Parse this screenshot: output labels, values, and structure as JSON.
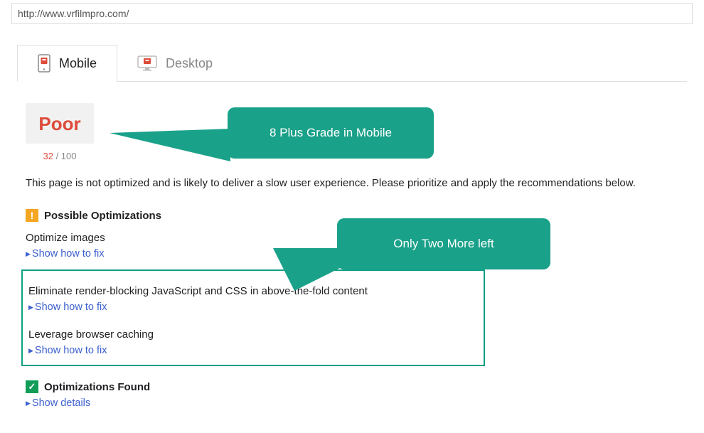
{
  "url": "http://www.vrfilmpro.com/",
  "tabs": {
    "mobile": "Mobile",
    "desktop": "Desktop"
  },
  "score": {
    "grade": "Poor",
    "value": "32",
    "sep": " / ",
    "max": "100"
  },
  "description": "This page is not optimized and is likely to deliver a slow user experience. Please prioritize and apply the recommendations below.",
  "sections": {
    "possible": "Possible Optimizations",
    "found": "Optimizations Found"
  },
  "opts": {
    "o1": "Optimize images",
    "o2": "Eliminate render-blocking JavaScript and CSS in above-the-fold content",
    "o3": "Leverage browser caching"
  },
  "links": {
    "fix": "Show how to fix",
    "details": "Show details"
  },
  "callouts": {
    "c1": "8 Plus Grade in Mobile",
    "c2": "Only Two More left"
  }
}
